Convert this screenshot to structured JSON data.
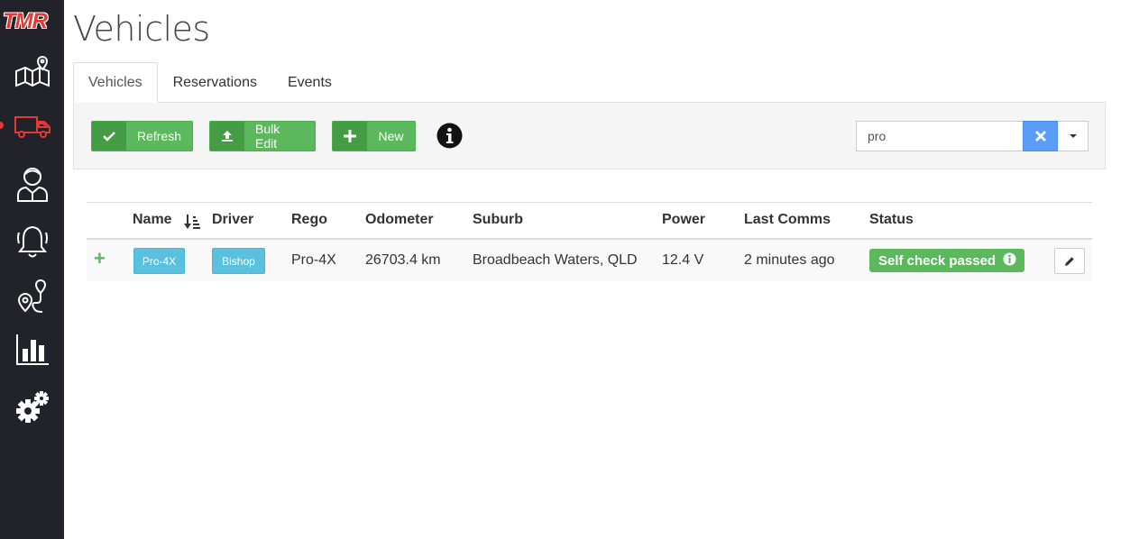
{
  "app": {
    "logo_text": "TMR",
    "colors": {
      "sidebar_bg": "#22222a",
      "accent_red": "#e53935",
      "success": "#5cb85c",
      "info": "#5bc0de",
      "primary": "#5b9cf6"
    }
  },
  "sidebar": {
    "items": [
      {
        "name": "map-icon",
        "active": false
      },
      {
        "name": "truck-icon",
        "active": true
      },
      {
        "name": "driver-icon",
        "active": false
      },
      {
        "name": "bell-icon",
        "active": false
      },
      {
        "name": "route-icon",
        "active": false
      },
      {
        "name": "bar-chart-icon",
        "active": false
      },
      {
        "name": "settings-icon",
        "active": false
      }
    ]
  },
  "page": {
    "title": "Vehicles"
  },
  "tabs": [
    {
      "label": "Vehicles",
      "active": true
    },
    {
      "label": "Reservations",
      "active": false
    },
    {
      "label": "Events",
      "active": false
    }
  ],
  "toolbar": {
    "refresh_label": "Refresh",
    "bulk_edit_label": "Bulk Edit",
    "new_label": "New",
    "search_value": "pro"
  },
  "table": {
    "headers": {
      "name": "Name",
      "driver": "Driver",
      "rego": "Rego",
      "odometer": "Odometer",
      "suburb": "Suburb",
      "power": "Power",
      "last_comms": "Last Comms",
      "status": "Status"
    },
    "rows": [
      {
        "name": "Pro-4X",
        "driver": "Bishop",
        "rego": "Pro-4X",
        "odometer": "26703.4 km",
        "suburb": "Broadbeach Waters, QLD",
        "power": "12.4 V",
        "last_comms": "2 minutes ago",
        "status": "Self check passed"
      }
    ]
  }
}
